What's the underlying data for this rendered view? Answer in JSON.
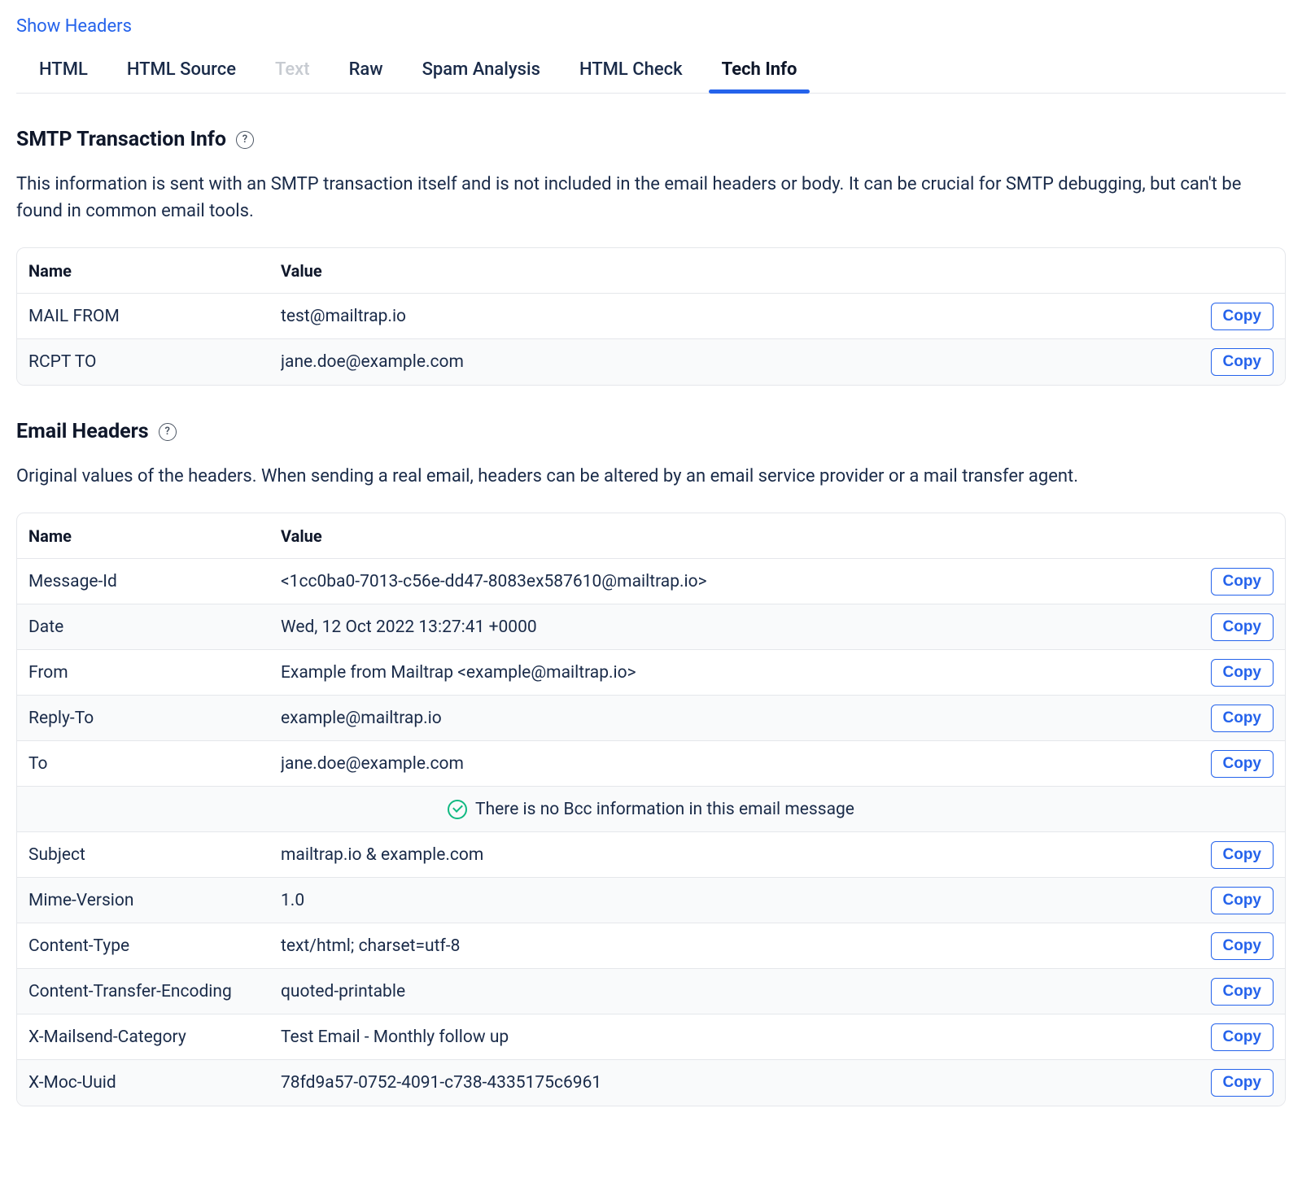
{
  "top_link": "Show Headers",
  "tabs": [
    {
      "label": "HTML",
      "active": false,
      "disabled": false
    },
    {
      "label": "HTML Source",
      "active": false,
      "disabled": false
    },
    {
      "label": "Text",
      "active": false,
      "disabled": true
    },
    {
      "label": "Raw",
      "active": false,
      "disabled": false
    },
    {
      "label": "Spam Analysis",
      "active": false,
      "disabled": false
    },
    {
      "label": "HTML Check",
      "active": false,
      "disabled": false
    },
    {
      "label": "Tech Info",
      "active": true,
      "disabled": false
    }
  ],
  "copy_label": "Copy",
  "table_headers": {
    "name": "Name",
    "value": "Value"
  },
  "smtp_section": {
    "title": "SMTP Transaction Info",
    "description": "This information is sent with an SMTP transaction itself and is not included in the email headers or body. It can be crucial for SMTP debugging, but can't be found in common email tools.",
    "rows": [
      {
        "name": "MAIL FROM",
        "value": "test@mailtrap.io"
      },
      {
        "name": "RCPT TO",
        "value": "jane.doe@example.com"
      }
    ]
  },
  "headers_section": {
    "title": "Email Headers",
    "description": "Original values of the headers. When sending a real email, headers can be altered by an email service provider or a mail transfer agent.",
    "bcc_message": "There is no Bcc information in this email message",
    "rows_a": [
      {
        "name": "Message-Id",
        "value": "<1cc0ba0-7013-c56e-dd47-8083ex587610@mailtrap.io>"
      },
      {
        "name": "Date",
        "value": "Wed, 12 Oct 2022 13:27:41 +0000"
      },
      {
        "name": "From",
        "value": "Example from Mailtrap <example@mailtrap.io>"
      },
      {
        "name": "Reply-To",
        "value": "example@mailtrap.io"
      },
      {
        "name": "To",
        "value": "jane.doe@example.com"
      }
    ],
    "rows_b": [
      {
        "name": "Subject",
        "value": "mailtrap.io & example.com"
      },
      {
        "name": "Mime-Version",
        "value": "1.0"
      },
      {
        "name": "Content-Type",
        "value": "text/html; charset=utf-8"
      },
      {
        "name": "Content-Transfer-Encoding",
        "value": "quoted-printable"
      },
      {
        "name": "X-Mailsend-Category",
        "value": "Test Email - Monthly follow up"
      },
      {
        "name": "X-Moc-Uuid",
        "value": "78fd9a57-0752-4091-c738-4335175c6961"
      }
    ]
  }
}
